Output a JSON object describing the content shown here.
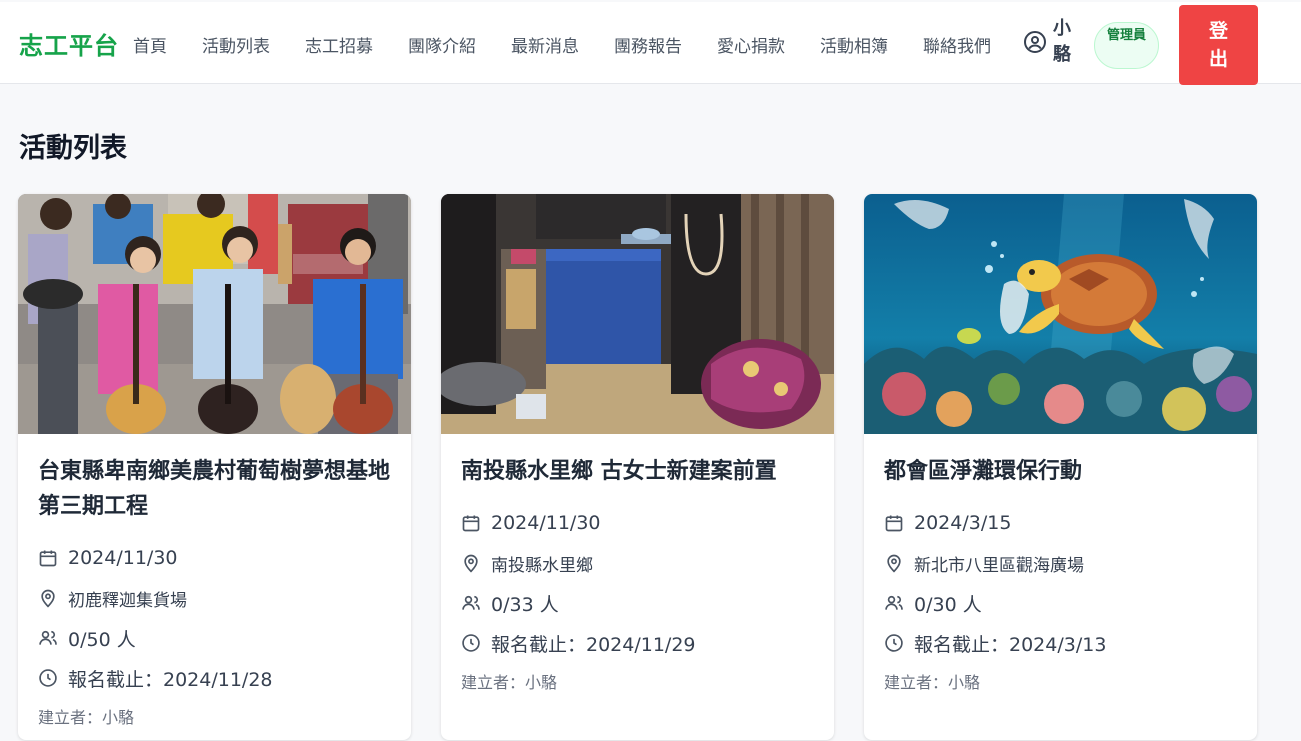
{
  "nav": {
    "brand": "志工平台",
    "links": [
      "首頁",
      "活動列表",
      "志工招募",
      "團隊介紹",
      "最新消息",
      "團務報告",
      "愛心捐款",
      "活動相簿",
      "聯絡我們"
    ],
    "user_name": "小駱",
    "role_badge": "管理員",
    "logout_label": "登出"
  },
  "page": {
    "title": "活動列表"
  },
  "activities": [
    {
      "title": "台東縣卑南鄉美農村葡萄樹夢想基地第三期工程",
      "date": "2024/11/30",
      "location": "初鹿釋迦集貨場",
      "participants": "0/50 人",
      "deadline": "報名截止：2024/11/28",
      "creator": "建立者：小駱"
    },
    {
      "title": "南投縣水里鄉 古女士新建案前置",
      "date": "2024/11/30",
      "location": "南投縣水里鄉",
      "participants": "0/33 人",
      "deadline": "報名截止：2024/11/29",
      "creator": "建立者：小駱"
    },
    {
      "title": "都會區淨灘環保行動",
      "date": "2024/3/15",
      "location": "新北市八里區觀海廣場",
      "participants": "0/30 人",
      "deadline": "報名截止：2024/3/13",
      "creator": "建立者：小駱"
    }
  ],
  "icons": {
    "date": "calendar-icon",
    "location": "map-pin-icon",
    "participants": "users-icon",
    "deadline": "clock-icon",
    "user": "user-circle-icon"
  },
  "colors": {
    "brand": "#16a34a",
    "logout": "#ef4444",
    "badge_bg": "#ecfdf3"
  }
}
